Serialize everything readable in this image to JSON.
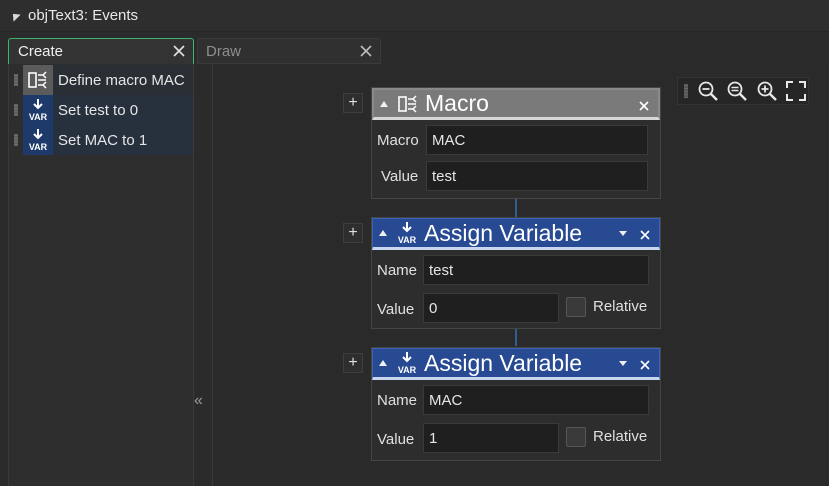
{
  "window": {
    "title": "objText3: Events"
  },
  "tabs": [
    {
      "label": "Create",
      "active": true
    },
    {
      "label": "Draw",
      "active": false
    }
  ],
  "events": [
    {
      "label": "Define macro MAC",
      "icon": "macro-icon"
    },
    {
      "label": "Set test to 0",
      "icon": "var-icon"
    },
    {
      "label": "Set MAC to 1",
      "icon": "var-icon"
    }
  ],
  "collapse_label": "«",
  "zoom": {
    "buttons": [
      "zoom-out-icon",
      "zoom-reset-icon",
      "zoom-in-icon",
      "fit-screen-icon"
    ]
  },
  "blocks": [
    {
      "title": "Macro",
      "type": "macro",
      "fields": [
        {
          "label": "Macro",
          "value": "MAC"
        },
        {
          "label": "Value",
          "value": "test"
        }
      ]
    },
    {
      "title": "Assign Variable",
      "type": "var",
      "fields": [
        {
          "label": "Name",
          "value": "test"
        },
        {
          "label": "Value",
          "value": "0",
          "relative_label": "Relative",
          "relative": false
        }
      ]
    },
    {
      "title": "Assign Variable",
      "type": "var",
      "fields": [
        {
          "label": "Name",
          "value": "MAC"
        },
        {
          "label": "Value",
          "value": "1",
          "relative_label": "Relative",
          "relative": false
        }
      ]
    }
  ],
  "icons": {
    "var_text": "VAR",
    "plus": "+"
  },
  "colors": {
    "accent_green": "#3cb371",
    "var_header": "#274a93",
    "macro_header": "#7a7a7a"
  }
}
